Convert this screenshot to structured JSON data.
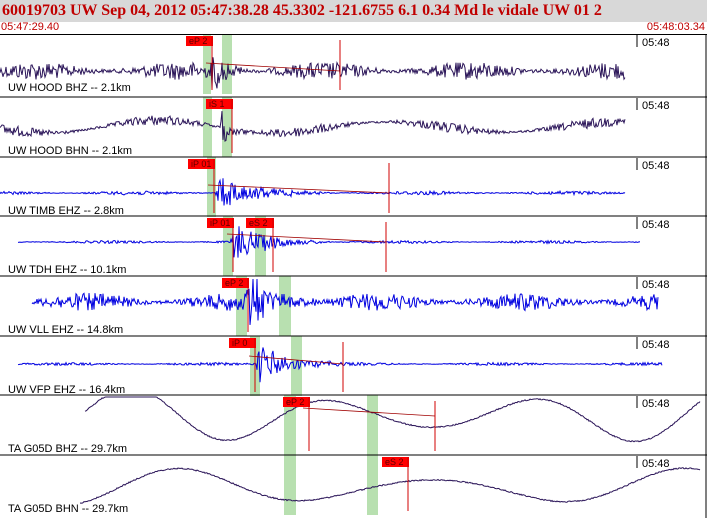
{
  "header": {
    "title": "60019703 UW Sep 04, 2012 05:47:38.28   45.3302 -121.6755  6.1 0.34 Md le vidale UW 01   2",
    "start_time": "05:47:29.40",
    "end_time": "05:48:03.34"
  },
  "colors": {
    "title": "#c00000",
    "pick_box": "#ff0000",
    "pick_band": "#b8e0b0",
    "trace_dark": "#2a1458",
    "trace_blue": "#0000e0"
  },
  "traces": [
    {
      "label": "UW HOOD BHZ -- 2.1km",
      "time_label": "05:48",
      "color": "dark",
      "picks": [
        {
          "label": "eP 2"
        }
      ]
    },
    {
      "label": "UW HOOD BHN -- 2.1km",
      "time_label": "05:48",
      "color": "dark",
      "picks": [
        {
          "label": "iS 1"
        }
      ]
    },
    {
      "label": "UW TIMB EHZ -- 2.8km",
      "time_label": "05:48",
      "color": "blue",
      "picks": [
        {
          "label": "iP 01"
        }
      ]
    },
    {
      "label": "UW TDH EHZ -- 10.1km",
      "time_label": "05:48",
      "color": "blue",
      "picks": [
        {
          "label": "iP 01"
        },
        {
          "label": "eS 2"
        }
      ]
    },
    {
      "label": "UW VLL EHZ -- 14.8km",
      "time_label": "05:48",
      "color": "blue",
      "picks": [
        {
          "label": "eP 2"
        }
      ]
    },
    {
      "label": "UW VFP EHZ -- 16.4km",
      "time_label": "05:48",
      "color": "blue",
      "picks": [
        {
          "label": "iP 0"
        }
      ]
    },
    {
      "label": "TA G05D BHZ -- 29.7km",
      "time_label": "05:48",
      "color": "dark",
      "picks": [
        {
          "label": "eP 2"
        }
      ]
    },
    {
      "label": "TA G05D BHN -- 29.7km",
      "time_label": "05:48",
      "color": "dark",
      "picks": [
        {
          "label": "eS 2"
        }
      ]
    }
  ]
}
